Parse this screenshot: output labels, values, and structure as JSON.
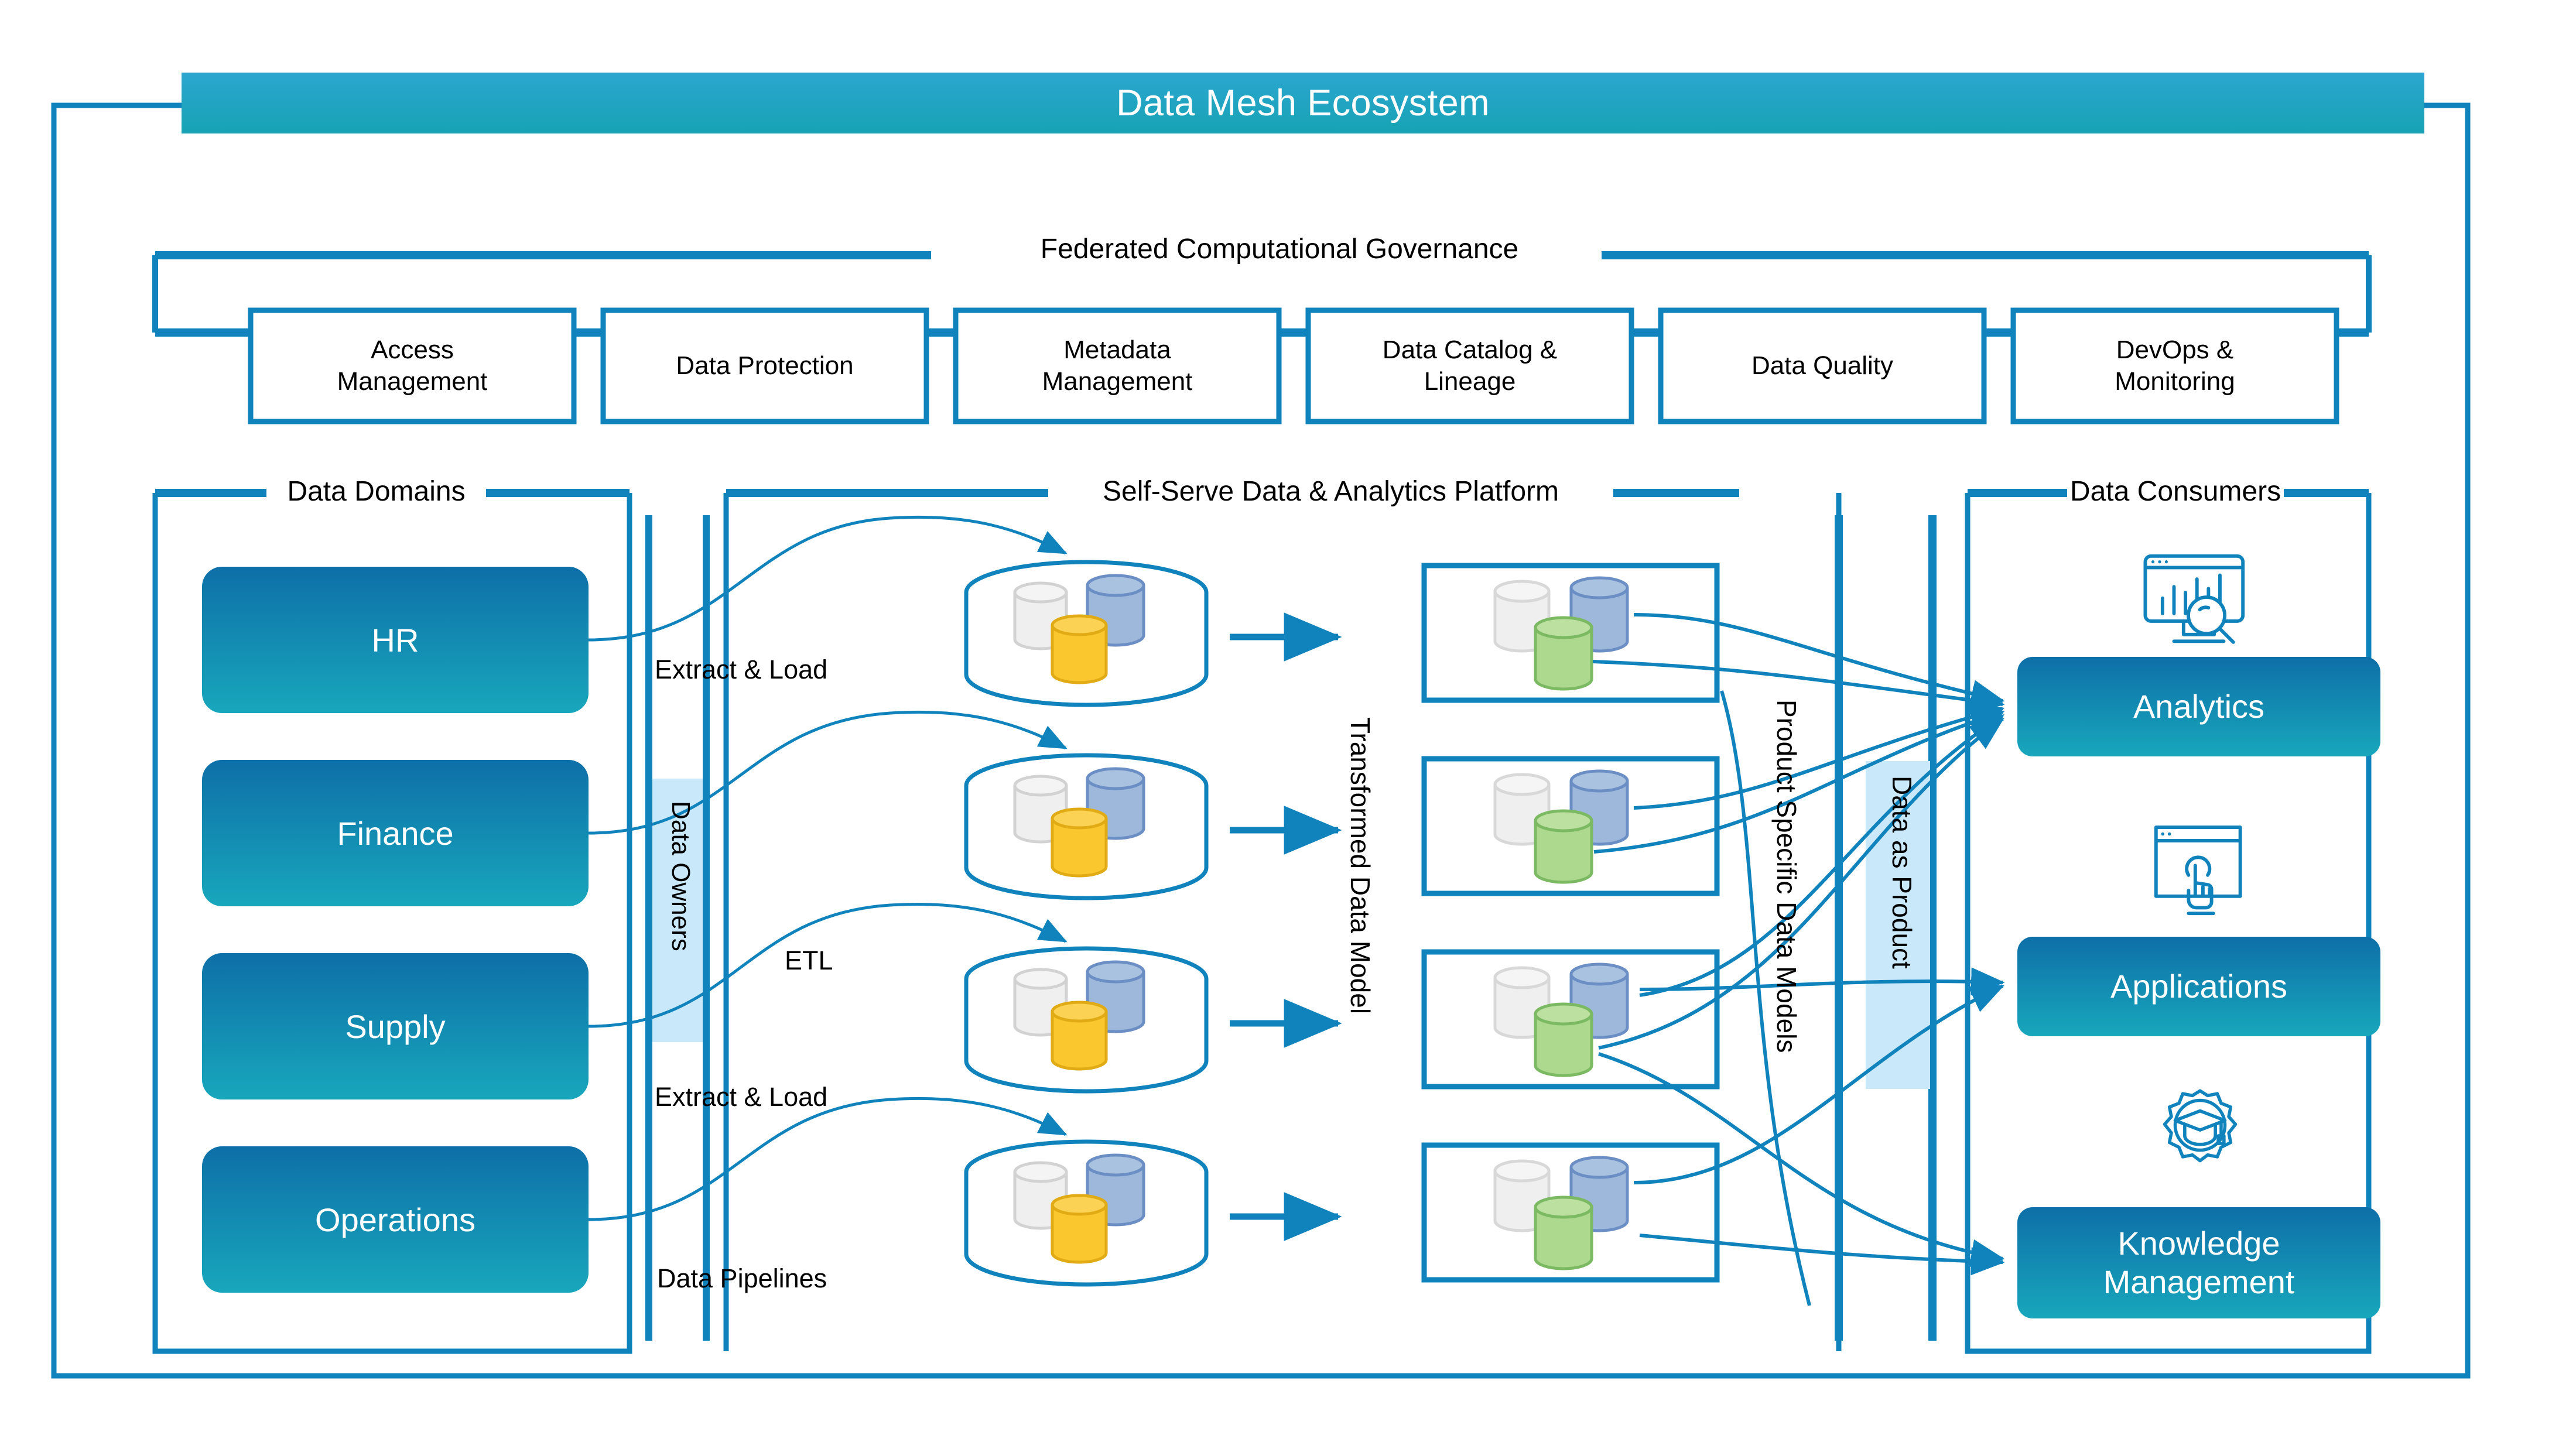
{
  "diagram": {
    "title": "Data Mesh Ecosystem",
    "title_colors": {
      "gradient_top": "#2ba6d0",
      "gradient_bottom": "#17a3b4",
      "text": "#ffffff"
    },
    "accent": "#1083bd",
    "line_color": "#1083bd",
    "highlight_bg": "#c9e8fa",
    "domain_gradient_top": "#0e6fa8",
    "domain_gradient_bottom": "#18a7bc"
  },
  "governance": {
    "title": "Federated Computational Governance",
    "items": [
      {
        "label": "Access\nManagement",
        "line1": "Access",
        "line2": "Management"
      },
      {
        "label": "Data Protection",
        "line1": "Data Protection",
        "line2": ""
      },
      {
        "label": "Metadata\nManagement",
        "line1": "Metadata",
        "line2": "Management"
      },
      {
        "label": "Data Catalog &\nLineage",
        "line1": "Data Catalog &",
        "line2": "Lineage"
      },
      {
        "label": "Data Quality",
        "line1": "Data Quality",
        "line2": ""
      },
      {
        "label": "DevOps &\nMonitoring",
        "line1": "DevOps &",
        "line2": "Monitoring"
      }
    ]
  },
  "domains": {
    "title": "Data Domains",
    "items": [
      {
        "label": "HR"
      },
      {
        "label": "Finance"
      },
      {
        "label": "Supply"
      },
      {
        "label": "Operations"
      }
    ],
    "owners_label": "Data Owners"
  },
  "platform": {
    "title": "Self-Serve Data & Analytics Platform",
    "flow_labels": [
      {
        "text": "Extract & Load"
      },
      {
        "text": "ETL"
      },
      {
        "text": "Extract & Load"
      },
      {
        "text": "Data Pipelines"
      }
    ],
    "transformed_label": "Transformed Data Model",
    "product_models_label": "Product Specific Data Models",
    "data_as_product_label": "Data as Product",
    "raw_store_count": 4,
    "product_box_count": 4,
    "store_cylinder_colors": {
      "gray": "#ececec",
      "blue": "#9db8da",
      "yellow": "#fbc72e"
    },
    "product_cylinder_colors": {
      "gray": "#efefef",
      "blue": "#9db8da",
      "green": "#add98f"
    }
  },
  "consumers": {
    "title": "Data Consumers",
    "items": [
      {
        "label": "Analytics",
        "icon": "analytics-monitor-magnifier-icon"
      },
      {
        "label": "Applications",
        "icon": "browser-touch-hand-icon"
      },
      {
        "label": "Knowledge\nManagement",
        "line1": "Knowledge",
        "line2": "Management",
        "icon": "gear-graduation-cap-icon"
      }
    ]
  }
}
